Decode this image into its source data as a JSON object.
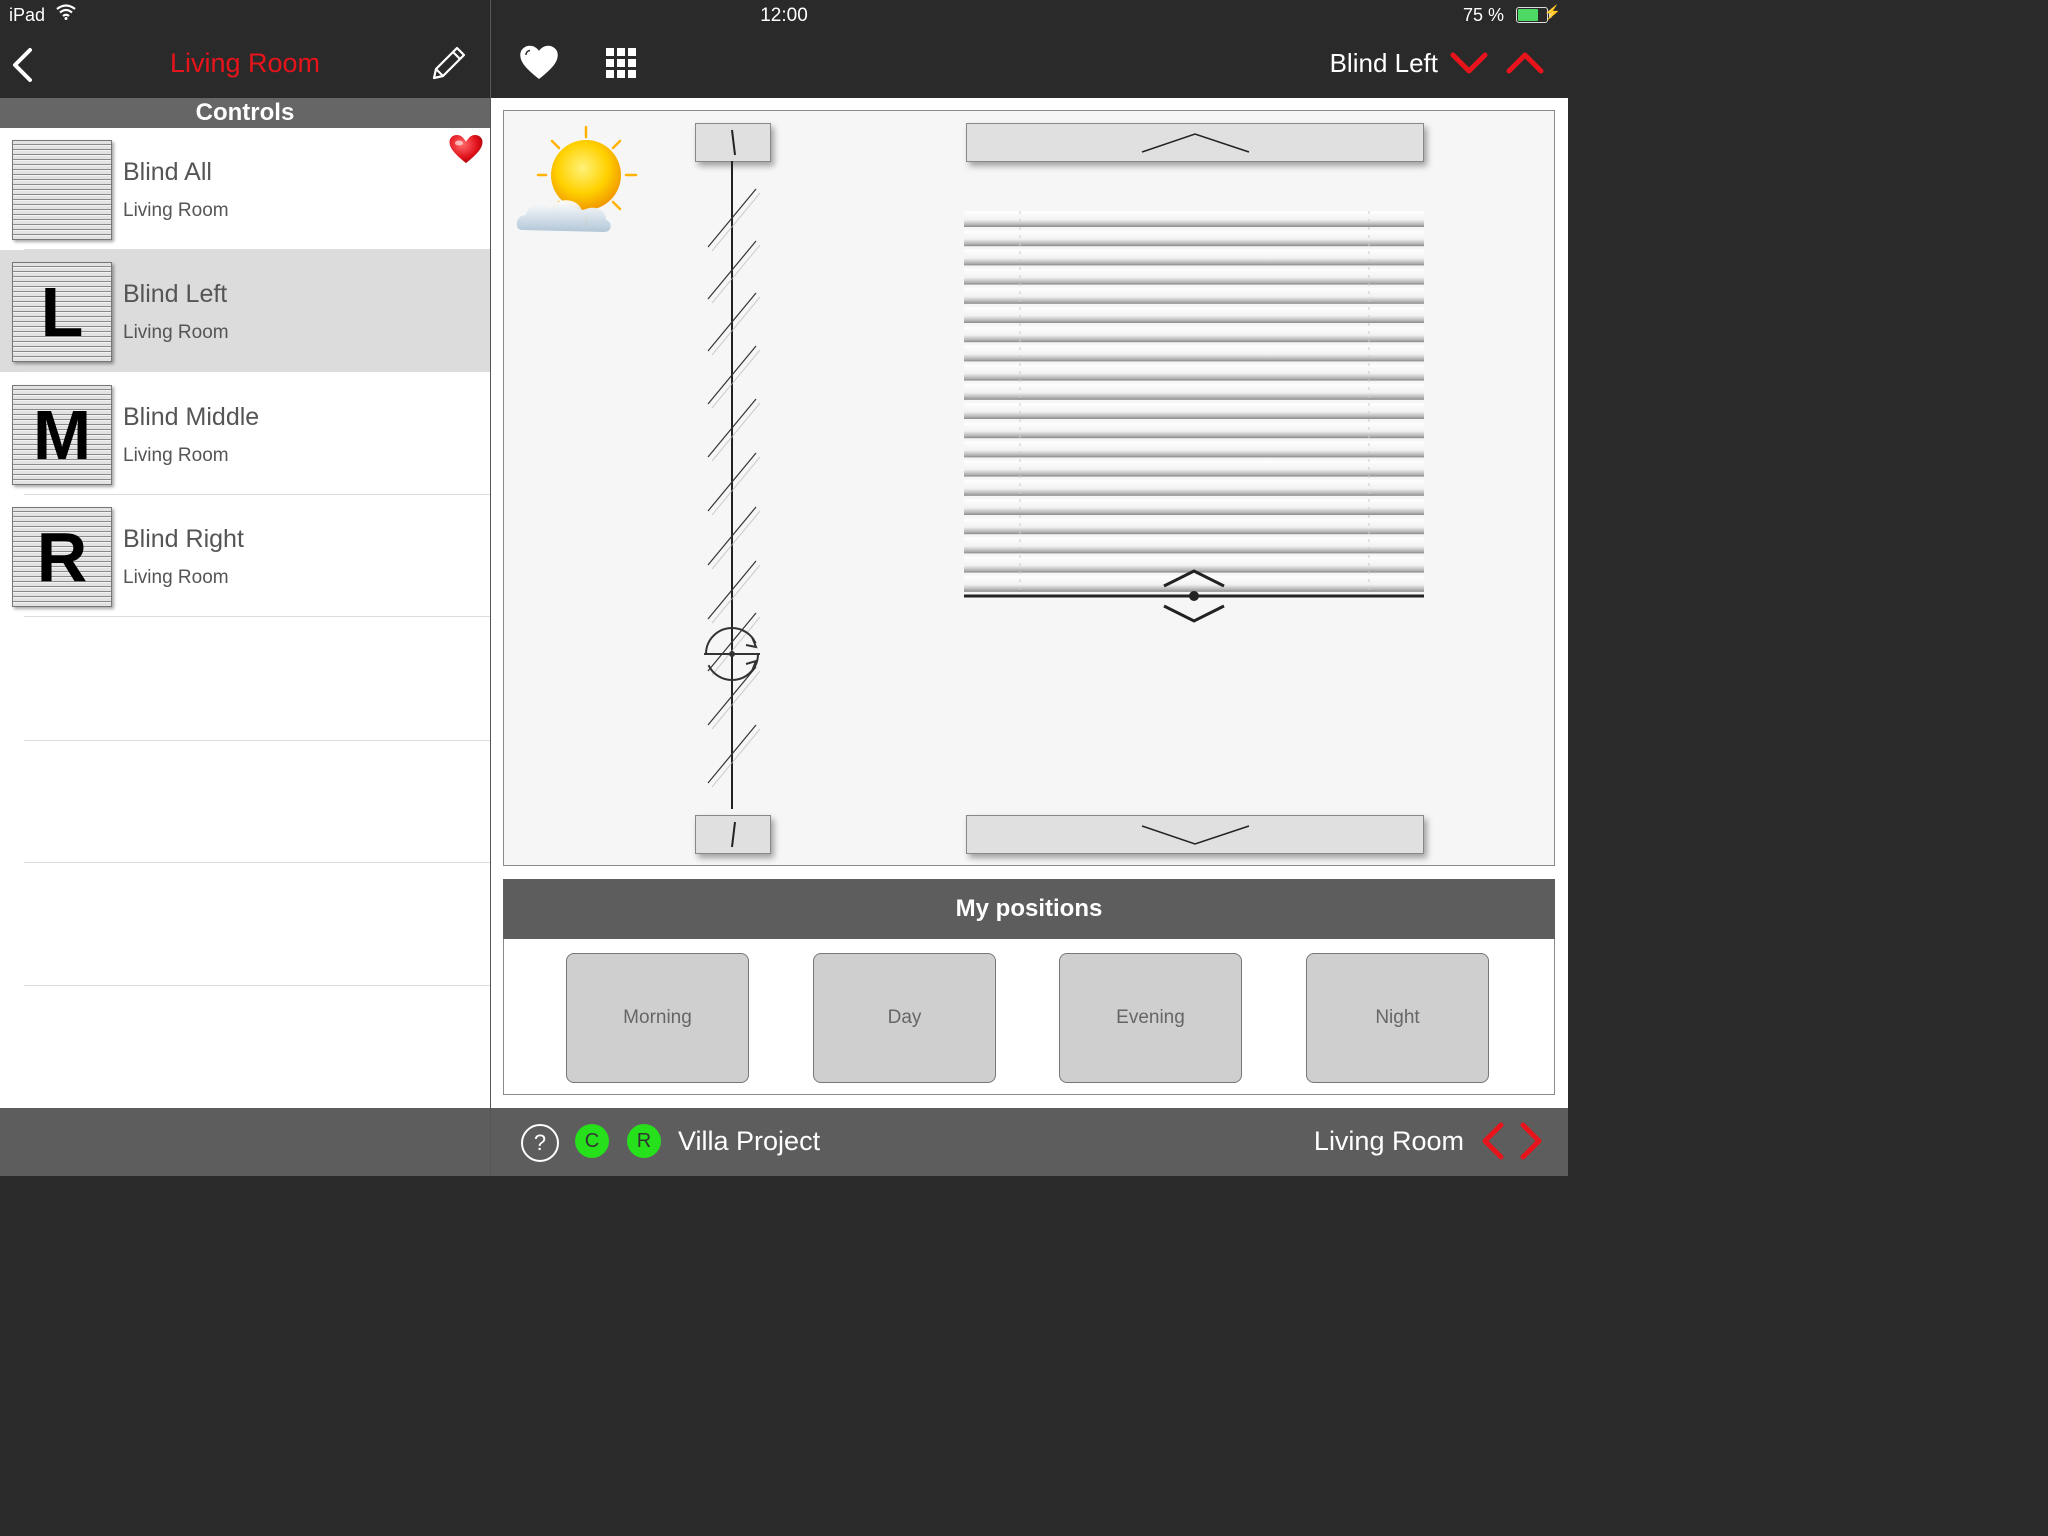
{
  "status_bar": {
    "device": "iPad",
    "time": "12:00",
    "battery": "75 %",
    "battery_level": 0.75
  },
  "left_header": {
    "title": "Living Room",
    "back_icon": "chevron-left-icon",
    "edit_icon": "pencil-icon"
  },
  "right_header": {
    "title": "Blind Left",
    "favorite_icon": "heart-icon",
    "grid_icon": "grid-icon",
    "down_icon": "chevron-down-icon",
    "up_icon": "chevron-up-icon"
  },
  "controls": {
    "header": "Controls",
    "items": [
      {
        "name": "Blind All",
        "room": "Living Room",
        "letter": "",
        "favorite": true,
        "selected": false
      },
      {
        "name": "Blind Left",
        "room": "Living Room",
        "letter": "L",
        "favorite": false,
        "selected": true
      },
      {
        "name": "Blind Middle",
        "room": "Living Room",
        "letter": "M",
        "favorite": false,
        "selected": false
      },
      {
        "name": "Blind Right",
        "room": "Living Room",
        "letter": "R",
        "favorite": false,
        "selected": false
      }
    ]
  },
  "blind_control": {
    "weather_icon": "sun-cloud-icon",
    "position": 1.0
  },
  "positions": {
    "header": "My positions",
    "buttons": [
      "Morning",
      "Day",
      "Evening",
      "Night"
    ]
  },
  "footer": {
    "help": "?",
    "badge_c": "C",
    "badge_r": "R",
    "project": "Villa Project",
    "room": "Living Room"
  },
  "colors": {
    "accent": "#e8141c",
    "dark": "#2a2a2a",
    "panel": "#5d5d5d",
    "green": "#26e01c"
  }
}
